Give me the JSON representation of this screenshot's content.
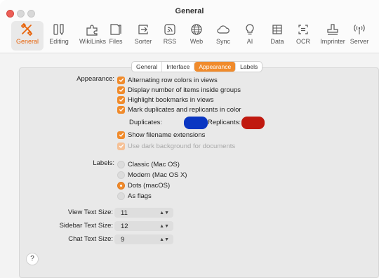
{
  "window": {
    "title": "General"
  },
  "toolbar": {
    "items": [
      {
        "label": "General",
        "icon": "tools-icon",
        "active": true
      },
      {
        "label": "Editing",
        "icon": "editing-icon"
      },
      {
        "label": "WikiLinks",
        "icon": "puzzle-icon"
      },
      {
        "label": "Files",
        "icon": "files-icon"
      },
      {
        "label": "Sorter",
        "icon": "sorter-icon"
      },
      {
        "label": "RSS",
        "icon": "rss-icon"
      },
      {
        "label": "Web",
        "icon": "globe-icon"
      },
      {
        "label": "Sync",
        "icon": "cloud-icon"
      },
      {
        "label": "AI",
        "icon": "lightbulb-icon"
      },
      {
        "label": "Data",
        "icon": "data-icon"
      },
      {
        "label": "OCR",
        "icon": "ocr-icon"
      },
      {
        "label": "Imprinter",
        "icon": "stamp-icon"
      },
      {
        "label": "Server",
        "icon": "server-icon"
      }
    ]
  },
  "tabs": {
    "items": [
      "General",
      "Interface",
      "Appearance",
      "Labels"
    ],
    "selected": "Appearance"
  },
  "appearance": {
    "label": "Appearance:",
    "options": [
      {
        "text": "Alternating row colors in views",
        "checked": true,
        "enabled": true
      },
      {
        "text": "Display number of items inside groups",
        "checked": true,
        "enabled": true
      },
      {
        "text": "Highlight bookmarks in views",
        "checked": true,
        "enabled": true
      },
      {
        "text": "Mark duplicates and replicants in color",
        "checked": true,
        "enabled": true
      }
    ],
    "duplicates_label": "Duplicates:",
    "duplicates_color": "#0a36c2",
    "replicants_label": "Replicants:",
    "replicants_color": "#c0190f",
    "extra_options": [
      {
        "text": "Show filename extensions",
        "checked": true,
        "enabled": true
      },
      {
        "text": "Use dark background for documents",
        "checked": true,
        "enabled": false
      }
    ]
  },
  "labels": {
    "label": "Labels:",
    "options": [
      {
        "text": "Classic (Mac OS)",
        "selected": false
      },
      {
        "text": "Modern (Mac OS X)",
        "selected": false
      },
      {
        "text": "Dots (macOS)",
        "selected": true
      },
      {
        "text": "As flags",
        "selected": false
      }
    ]
  },
  "text_sizes": [
    {
      "label": "View Text Size:",
      "value": "11"
    },
    {
      "label": "Sidebar Text Size:",
      "value": "12"
    },
    {
      "label": "Chat Text Size:",
      "value": "9"
    }
  ],
  "help": {
    "label": "?"
  },
  "colors": {
    "accent": "#f08b2c",
    "active_tab_label": "#e8630a"
  }
}
